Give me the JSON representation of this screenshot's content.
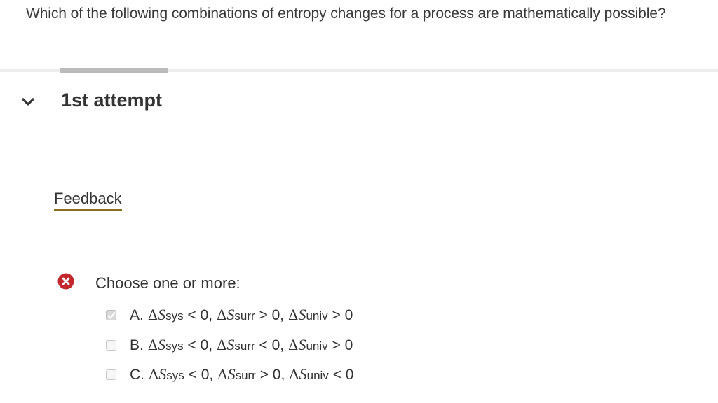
{
  "question": {
    "text": "Which of the following combinations of entropy changes for a process are mathematically possible?"
  },
  "attempt": {
    "title": "1st attempt",
    "toggle_icon": "chevron-down-icon"
  },
  "feedback": {
    "link_label": "Feedback"
  },
  "answer": {
    "status_icon": "incorrect-x-icon",
    "status_color": "#c1272d",
    "prompt": "Choose one or more:",
    "options": [
      {
        "letter": "A.",
        "checked": true,
        "terms": [
          {
            "sub": "sys",
            "rel": "< 0,"
          },
          {
            "sub": "surr",
            "rel": "> 0,"
          },
          {
            "sub": "univ",
            "rel": "> 0"
          }
        ]
      },
      {
        "letter": "B.",
        "checked": false,
        "terms": [
          {
            "sub": "sys",
            "rel": "< 0,"
          },
          {
            "sub": "surr",
            "rel": "< 0,"
          },
          {
            "sub": "univ",
            "rel": "> 0"
          }
        ]
      },
      {
        "letter": "C.",
        "checked": false,
        "terms": [
          {
            "sub": "sys",
            "rel": "< 0,"
          },
          {
            "sub": "surr",
            "rel": "> 0,"
          },
          {
            "sub": "univ",
            "rel": "< 0"
          }
        ]
      }
    ],
    "delta_symbol": "Δ",
    "entropy_symbol": "S"
  }
}
